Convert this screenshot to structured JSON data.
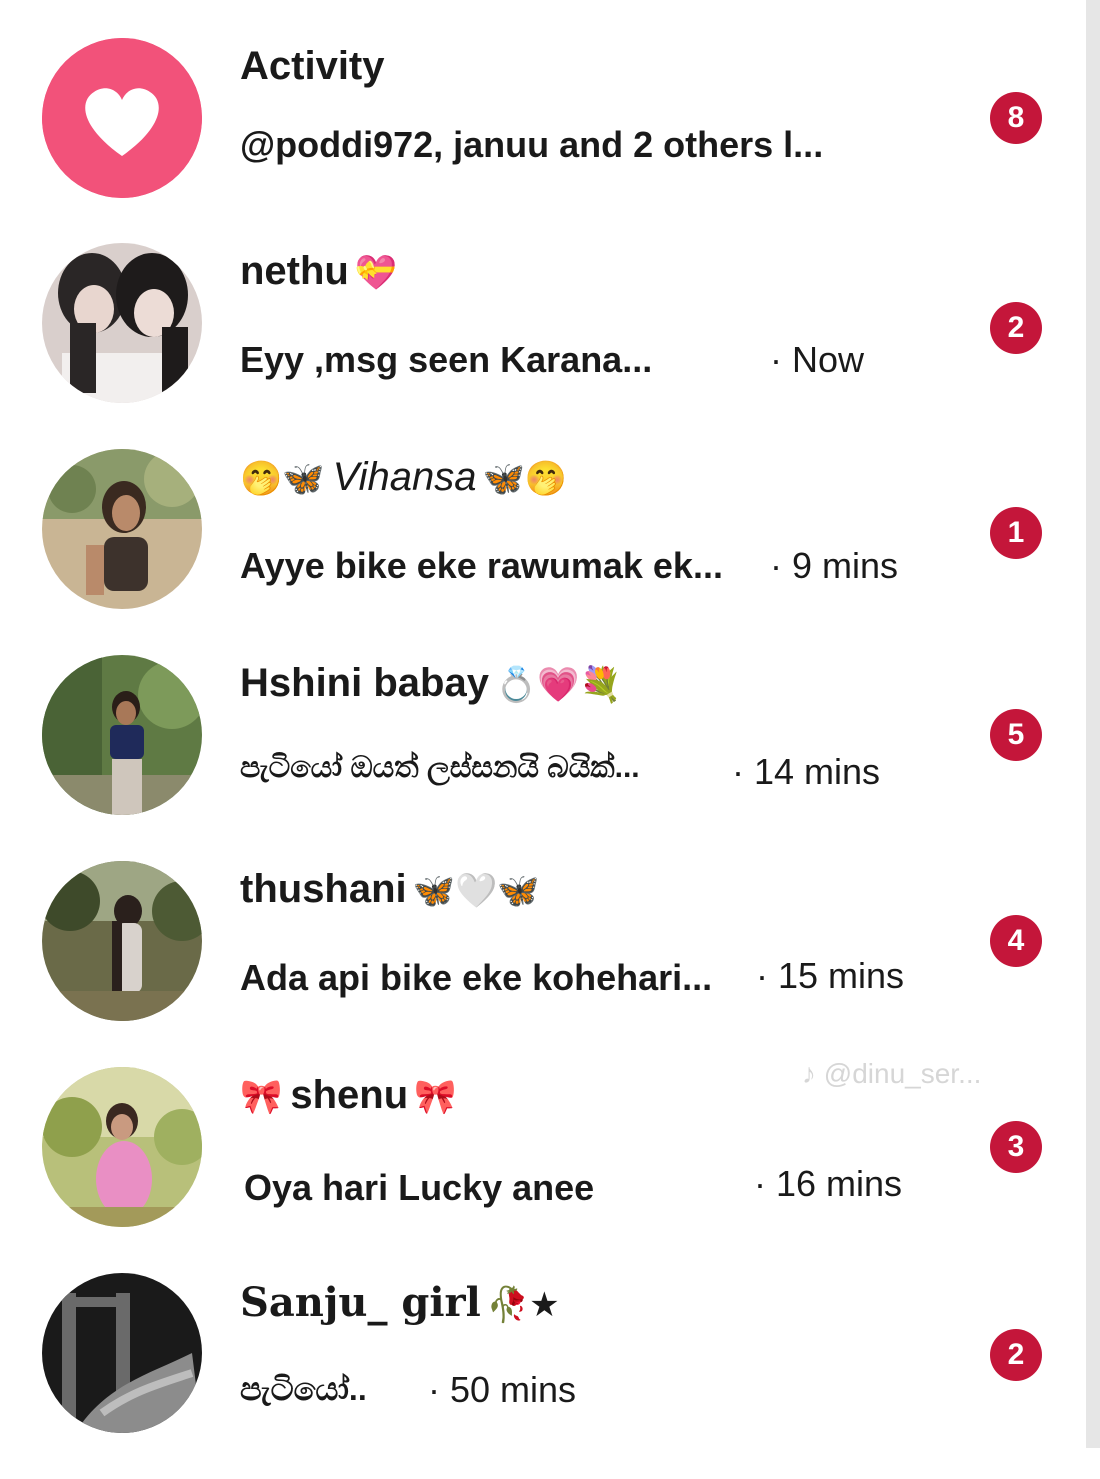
{
  "colors": {
    "badge": "#c4163a",
    "activity_circle": "#f2527a"
  },
  "activity": {
    "icon": "heart-icon",
    "title": "Activity",
    "preview": "@poddi972, januu and 2 others l...",
    "badge": "8"
  },
  "chats": [
    {
      "name": "nethu",
      "emoji_after": "💝",
      "preview": "Eyy ,msg seen Karana...",
      "time": "· Now",
      "badge": "2"
    },
    {
      "emoji_before": "🤭🦋",
      "name": "Vihansa",
      "emoji_after": "🦋🤭",
      "preview": "Ayye bike eke rawumak ek...",
      "time": "· 9 mins",
      "badge": "1"
    },
    {
      "name": "Hshini babay",
      "emoji_after": "💍💗💐",
      "preview": "පැටියෝ ඔයත් ලස්සනයි බයික්...",
      "time": "· 14 mins",
      "badge": "5"
    },
    {
      "name": "thushani",
      "emoji_after": "🦋🤍🦋",
      "preview": "Ada api bike eke kohehari...",
      "time": "· 15 mins",
      "badge": "4"
    },
    {
      "emoji_before": "🎀",
      "name": "shenu",
      "emoji_after": "🎀",
      "preview": "Oya hari Lucky anee",
      "time": "· 16 mins",
      "badge": "3"
    },
    {
      "name": "Sanju_ girl",
      "emoji_after": "🥀★",
      "preview": "පැටියෝ..",
      "time": "· 50 mins",
      "badge": "2"
    }
  ],
  "watermark": "♪ @dinu_ser..."
}
